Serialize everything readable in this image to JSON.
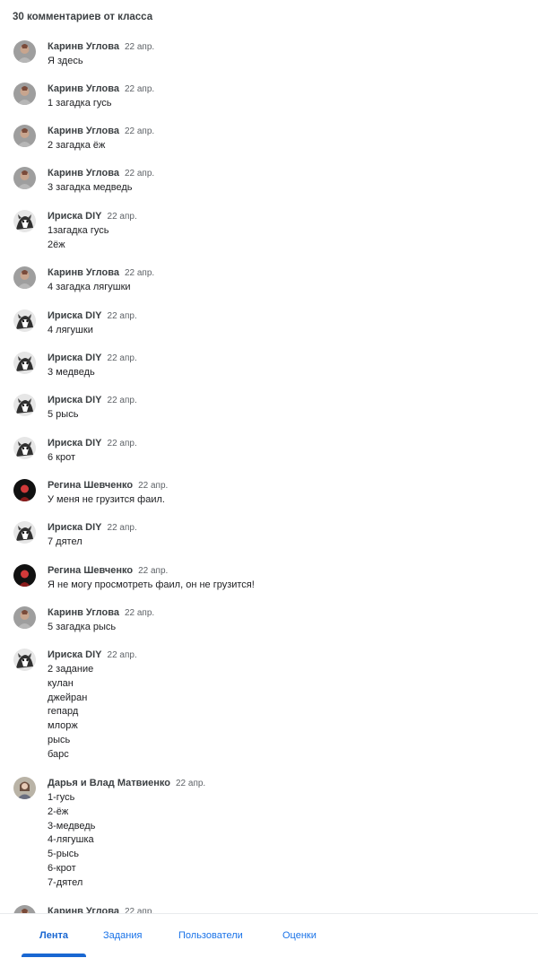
{
  "header": {
    "title": "30 комментариев от класса"
  },
  "comments": [
    {
      "author": "Каринв Углова",
      "date": "22 апр.",
      "text": "Я здесь",
      "avatar": "karina"
    },
    {
      "author": "Каринв Углова",
      "date": "22 апр.",
      "text": "1 загадка гусь",
      "avatar": "karina"
    },
    {
      "author": "Каринв Углова",
      "date": "22 апр.",
      "text": "2 загадка ёж",
      "avatar": "karina"
    },
    {
      "author": "Каринв Углова",
      "date": "22 апр.",
      "text": "3 загадка медведь",
      "avatar": "karina"
    },
    {
      "author": "Ириска DIY",
      "date": "22 апр.",
      "text": "1загадка гусь\n2ёж",
      "avatar": "iriska"
    },
    {
      "author": "Каринв Углова",
      "date": "22 апр.",
      "text": "4 загадка лягушки",
      "avatar": "karina"
    },
    {
      "author": "Ириска DIY",
      "date": "22 апр.",
      "text": "4 лягушки",
      "avatar": "iriska"
    },
    {
      "author": "Ириска DIY",
      "date": "22 апр.",
      "text": "3 медведь",
      "avatar": "iriska"
    },
    {
      "author": "Ириска DIY",
      "date": "22 апр.",
      "text": "5 рысь",
      "avatar": "iriska"
    },
    {
      "author": "Ириска DIY",
      "date": "22 апр.",
      "text": "6 крот",
      "avatar": "iriska"
    },
    {
      "author": "Регина Шевченко",
      "date": "22 апр.",
      "text": "У меня не грузится фаил.",
      "avatar": "regina"
    },
    {
      "author": "Ириска DIY",
      "date": "22 апр.",
      "text": "7 дятел",
      "avatar": "iriska"
    },
    {
      "author": "Регина Шевченко",
      "date": "22 апр.",
      "text": "Я не могу просмотреть фаил, он не грузится!",
      "avatar": "regina"
    },
    {
      "author": "Каринв Углова",
      "date": "22 апр.",
      "text": "5 загадка рысь",
      "avatar": "karina"
    },
    {
      "author": "Ириска DIY",
      "date": "22 апр.",
      "text": "2 задание\nкулан\nджейран\nгепард\nмлорж\nрысь\nбарс",
      "avatar": "iriska"
    },
    {
      "author": "Дарья и Влад Матвиенко",
      "date": "22 апр.",
      "text": "1-гусь\n2-ёж\n3-медведь\n4-лягушка\n5-рысь\n6-крот\n7-дятел",
      "avatar": "darya"
    },
    {
      "author": "Каринв Углова",
      "date": "22 апр.",
      "text": "",
      "avatar": "karina"
    }
  ],
  "tabs": [
    {
      "label": "Лента",
      "active": true
    },
    {
      "label": "Задания",
      "active": false
    },
    {
      "label": "Пользователи",
      "active": false
    },
    {
      "label": "Оценки",
      "active": false
    }
  ],
  "colors": {
    "accent": "#1967d2",
    "link": "#1a73e8"
  }
}
